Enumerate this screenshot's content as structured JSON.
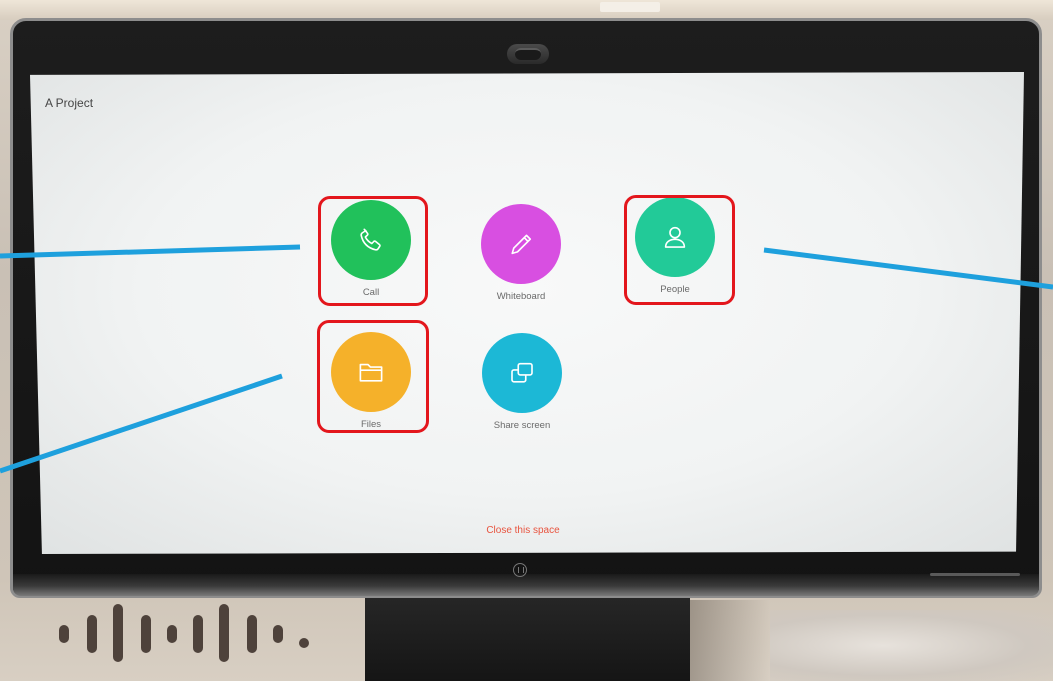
{
  "space": {
    "title": "A Project",
    "actions": [
      {
        "label": "Call",
        "icon": "phone-icon",
        "color": "#21c15b"
      },
      {
        "label": "Whiteboard",
        "icon": "pencil-icon",
        "color": "#d84fe1"
      },
      {
        "label": "People",
        "icon": "person-icon",
        "color": "#22ca98"
      },
      {
        "label": "Files",
        "icon": "folder-icon",
        "color": "#f5b12a"
      },
      {
        "label": "Share screen",
        "icon": "share-screen-icon",
        "color": "#1cb8d6"
      }
    ],
    "close_label": "Close this space",
    "close_color": "#e8543f"
  },
  "annotations": {
    "highlighted_actions": [
      "Call",
      "People",
      "Files"
    ],
    "highlight_color": "#e3161c",
    "pointer_color": "#1ea0dd"
  }
}
